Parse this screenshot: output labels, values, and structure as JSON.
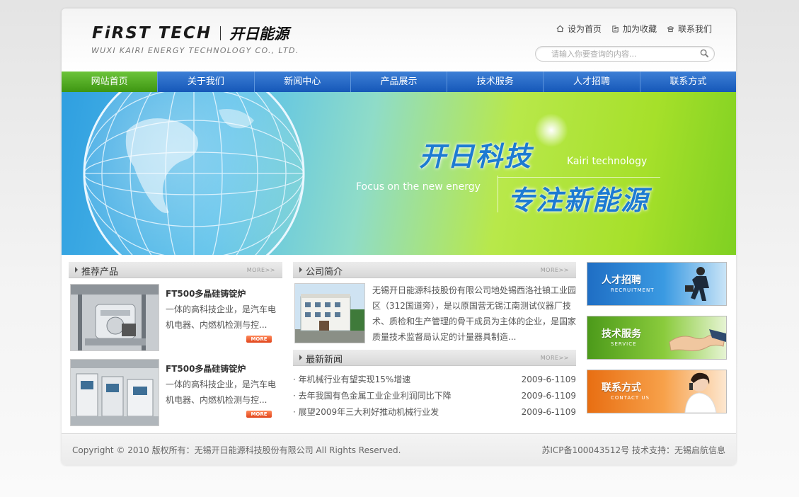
{
  "header": {
    "logo_en": "FiRST TECH",
    "logo_cn": "开日能源",
    "logo_sub": "WUXI KAIRI ENERGY TECHNOLOGY CO., LTD.",
    "links": [
      "设为首页",
      "加为收藏",
      "联系我们"
    ],
    "search_placeholder": "请输入你要查询的内容..."
  },
  "nav": [
    "网站首页",
    "关于我们",
    "新闻中心",
    "产品展示",
    "技术服务",
    "人才招聘",
    "联系方式"
  ],
  "banner": {
    "title_cn": "开日科技",
    "title_en": "Kairi technology",
    "slogan_en": "Focus on the new energy",
    "slogan_cn": "专注新能源"
  },
  "products": {
    "title": "推荐产品",
    "more": "MORE>>",
    "items": [
      {
        "name": "FT500多晶硅铸锭炉",
        "desc": "一体的高科技企业，是汽车电机电器、内燃机检测与控...",
        "more": "MORE"
      },
      {
        "name": "FT500多晶硅铸锭炉",
        "desc": "一体的高科技企业，是汽车电机电器、内燃机检测与控...",
        "more": "MORE"
      }
    ]
  },
  "intro": {
    "title": "公司简介",
    "more": "MORE>>",
    "text": "无锡开日能源科技股份有限公司地处锡西洛社镇工业园区（312国道旁），是以原国营无锡江南测试仪器厂技术、质检和生产管理的骨干成员为主体的企业，是国家质量技术监督局认定的计量器具制造..."
  },
  "news": {
    "title": "最新新闻",
    "more": "MORE>>",
    "items": [
      {
        "title": "· 年机械行业有望实现15%增速",
        "date": "2009-6-1109"
      },
      {
        "title": "· 去年我国有色金属工业企业利润同比下降",
        "date": "2009-6-1109"
      },
      {
        "title": "· 展望2009年三大利好推动机械行业发",
        "date": "2009-6-1109"
      }
    ]
  },
  "ads": [
    {
      "cn": "人才招聘",
      "en": "RECRUITMENT"
    },
    {
      "cn": "技术服务",
      "en": "SERVICE"
    },
    {
      "cn": "联系方式",
      "en": "CONTACT US"
    }
  ],
  "footer": {
    "copyright": "Copyright © 2010 版权所有：无锡开日能源科技股份有限公司 All Rights Reserved.",
    "icp": "苏ICP备100043512号 技术支持：无锡启航信息"
  }
}
